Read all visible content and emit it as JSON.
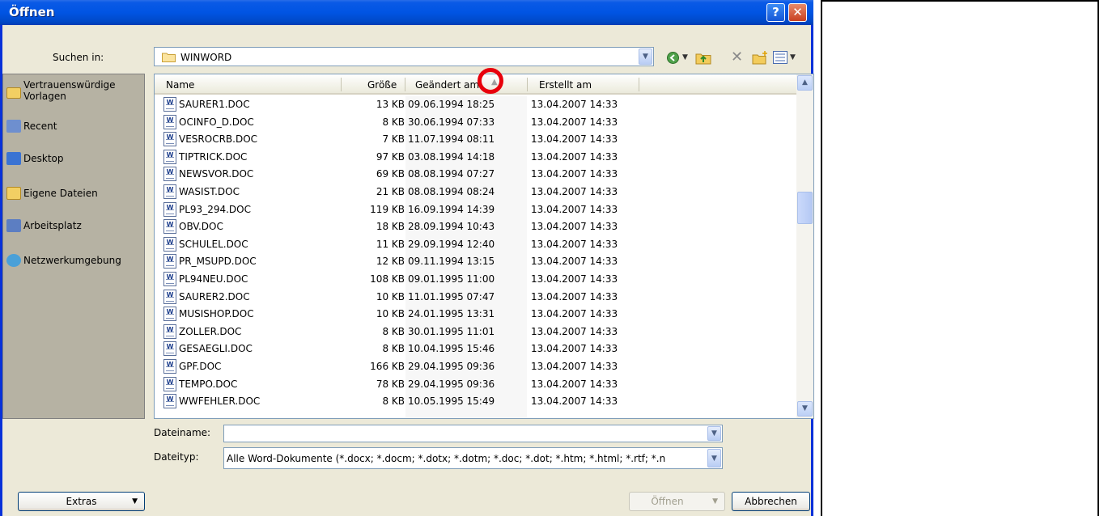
{
  "dialog": {
    "title": "Öffnen",
    "help_glyph": "?",
    "close_glyph": "✕"
  },
  "lookin": {
    "label": "Suchen in:",
    "value": "WINWORD"
  },
  "toolbar": {
    "icons": [
      "back-icon",
      "up-folder-icon",
      "delete-icon",
      "new-folder-icon",
      "views-icon"
    ]
  },
  "places": [
    {
      "label": "Vertrauenswürdige Vorlagen",
      "icon": "folder-icon",
      "color": "#f2cf63"
    },
    {
      "label": "Recent",
      "icon": "recent-icon",
      "color": "#6e8fcf"
    },
    {
      "label": "Desktop",
      "icon": "desktop-icon",
      "color": "#3a73d3"
    },
    {
      "label": "Eigene Dateien",
      "icon": "my-documents-icon",
      "color": "#f2cf63"
    },
    {
      "label": "Arbeitsplatz",
      "icon": "my-computer-icon",
      "color": "#5c7ec2"
    },
    {
      "label": "Netzwerkumgebung",
      "icon": "network-icon",
      "color": "#4aa0d8"
    }
  ],
  "columns": {
    "name": "Name",
    "size": "Größe",
    "modified": "Geändert am",
    "created": "Erstellt am"
  },
  "files": [
    {
      "name": "SAURER1.DOC",
      "size": "13 KB",
      "modified": "09.06.1994 18:25",
      "created": "13.04.2007 14:33"
    },
    {
      "name": "OCINFO_D.DOC",
      "size": "8 KB",
      "modified": "30.06.1994 07:33",
      "created": "13.04.2007 14:33"
    },
    {
      "name": "VESROCRB.DOC",
      "size": "7 KB",
      "modified": "11.07.1994 08:11",
      "created": "13.04.2007 14:33"
    },
    {
      "name": "TIPTRICK.DOC",
      "size": "97 KB",
      "modified": "03.08.1994 14:18",
      "created": "13.04.2007 14:33"
    },
    {
      "name": "NEWSVOR.DOC",
      "size": "69 KB",
      "modified": "08.08.1994 07:27",
      "created": "13.04.2007 14:33"
    },
    {
      "name": "WASIST.DOC",
      "size": "21 KB",
      "modified": "08.08.1994 08:24",
      "created": "13.04.2007 14:33"
    },
    {
      "name": "PL93_294.DOC",
      "size": "119 KB",
      "modified": "16.09.1994 14:39",
      "created": "13.04.2007 14:33"
    },
    {
      "name": "OBV.DOC",
      "size": "18 KB",
      "modified": "28.09.1994 10:43",
      "created": "13.04.2007 14:33"
    },
    {
      "name": "SCHULEL.DOC",
      "size": "11 KB",
      "modified": "29.09.1994 12:40",
      "created": "13.04.2007 14:33"
    },
    {
      "name": "PR_MSUPD.DOC",
      "size": "12 KB",
      "modified": "09.11.1994 13:15",
      "created": "13.04.2007 14:33"
    },
    {
      "name": "PL94NEU.DOC",
      "size": "108 KB",
      "modified": "09.01.1995 11:00",
      "created": "13.04.2007 14:33"
    },
    {
      "name": "SAURER2.DOC",
      "size": "10 KB",
      "modified": "11.01.1995 07:47",
      "created": "13.04.2007 14:33"
    },
    {
      "name": "MUSISHOP.DOC",
      "size": "10 KB",
      "modified": "24.01.1995 13:31",
      "created": "13.04.2007 14:33"
    },
    {
      "name": "ZOLLER.DOC",
      "size": "8 KB",
      "modified": "30.01.1995 11:01",
      "created": "13.04.2007 14:33"
    },
    {
      "name": "GESAEGLI.DOC",
      "size": "8 KB",
      "modified": "10.04.1995 15:46",
      "created": "13.04.2007 14:33"
    },
    {
      "name": "GPF.DOC",
      "size": "166 KB",
      "modified": "29.04.1995 09:36",
      "created": "13.04.2007 14:33"
    },
    {
      "name": "TEMPO.DOC",
      "size": "78 KB",
      "modified": "29.04.1995 09:36",
      "created": "13.04.2007 14:33"
    },
    {
      "name": "WWFEHLER.DOC",
      "size": "8 KB",
      "modified": "10.05.1995 15:49",
      "created": "13.04.2007 14:33"
    }
  ],
  "filename": {
    "label": "Dateiname:",
    "value": ""
  },
  "filetype": {
    "label": "Dateityp:",
    "value": "Alle Word-Dokumente (*.docx; *.docm; *.dotx; *.dotm; *.doc; *.dot; *.htm; *.html; *.rtf; *.n"
  },
  "buttons": {
    "extras": "Extras",
    "open": "Öffnen",
    "cancel": "Abbrechen"
  },
  "colors": {
    "titlebar": "#0054e3",
    "dialog_bg": "#ece9d8",
    "places_bg": "#b6b2a3",
    "highlight_marker": "#e8000b"
  }
}
